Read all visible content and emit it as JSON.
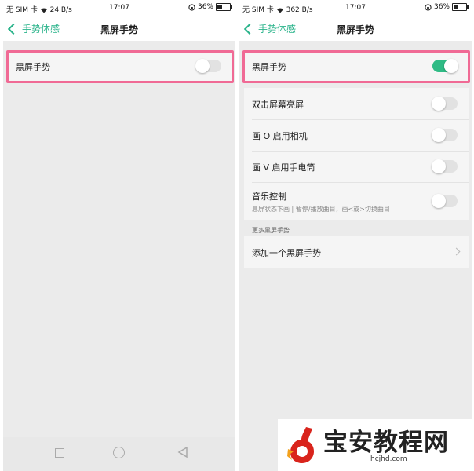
{
  "status_bar": {
    "left": {
      "carrier": "无 SIM 卡",
      "speed": "24 B/s",
      "time": "17:07",
      "battery": "36%"
    },
    "right": {
      "carrier": "无 SIM 卡",
      "speed": "362 B/s",
      "time": "17:07",
      "battery": "36%"
    },
    "battery_level": 0.36
  },
  "nav": {
    "back_label": "手势体感",
    "title": "黑屏手势"
  },
  "left_screen": {
    "main_toggle": {
      "label": "黑屏手势",
      "on": false
    }
  },
  "right_screen": {
    "main_toggle": {
      "label": "黑屏手势",
      "on": true
    },
    "options": [
      {
        "label": "双击屏幕亮屏",
        "on": false
      },
      {
        "label": "画 O 启用相机",
        "on": false
      },
      {
        "label": "画 V 启用手电筒",
        "on": false
      },
      {
        "label": "音乐控制",
        "sublabel": "息屏状态下画 | 暂停/播放曲目，画<或>切换曲目",
        "on": false
      }
    ],
    "more_section": {
      "header": "更多黑屏手势",
      "add_label": "添加一个黑屏手势"
    }
  },
  "colors": {
    "accent": "#29b38a",
    "toggle_on": "#2fbb85",
    "highlight": "#f06a95"
  },
  "watermark": {
    "text": "宝安教程网",
    "url": "hcjhd.com"
  }
}
